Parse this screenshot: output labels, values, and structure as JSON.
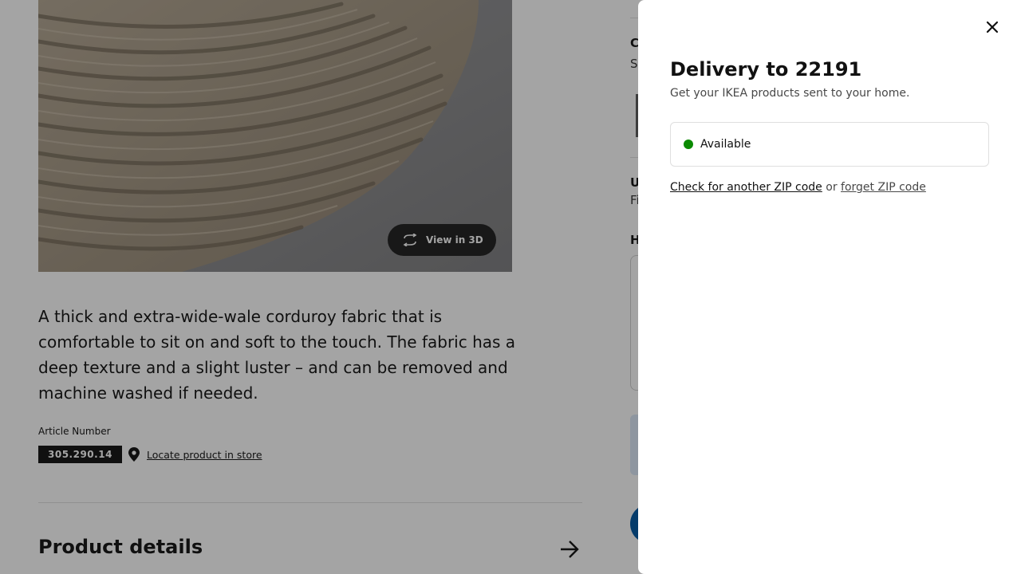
{
  "product": {
    "view_3d_label": "View in 3D",
    "description": "A thick and extra-wide-wale corduroy fabric that is comfortable to sit on and soft to the touch. The fabric has a deep texture and a slight luster – and can be removed and machine washed if needed.",
    "article_label": "Article Number",
    "article_number": "305.290.14",
    "locate_label": "Locate product in store",
    "details_title": "Product details"
  },
  "right_column": {
    "c_letter": "C",
    "s_letter": "Sa",
    "u_letter": "U",
    "f_letter": "Fi",
    "h_letter": "H"
  },
  "modal": {
    "title": "Delivery to 22191",
    "subtitle": "Get your IKEA products sent to your home.",
    "status_text": "Available",
    "check_link": "Check for another ZIP code",
    "or_text": "or",
    "forget_link": "forget ZIP code"
  },
  "colors": {
    "available_dot": "#0a8a00",
    "ikea_blue": "#0058a3",
    "fabric": "#a89a86"
  },
  "icons": {
    "close": "close-icon",
    "view_3d": "rotate-3d-icon",
    "pin": "location-pin-icon",
    "arrow": "arrow-right-icon"
  }
}
